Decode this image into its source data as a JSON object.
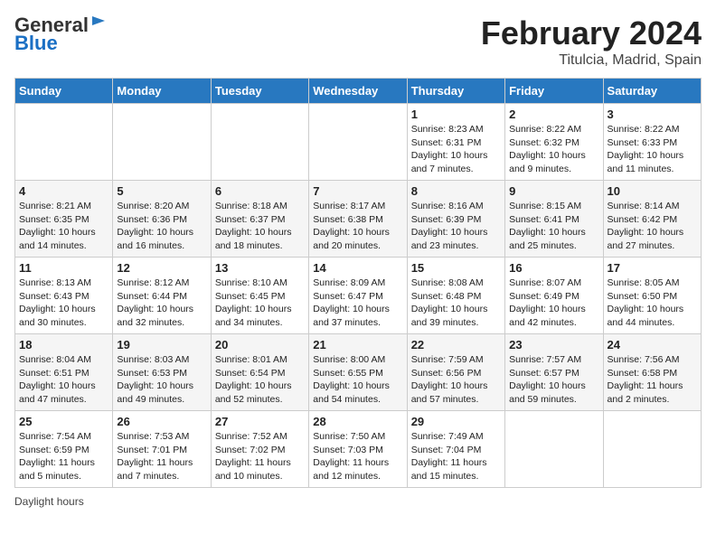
{
  "header": {
    "logo_general": "General",
    "logo_blue": "Blue",
    "month": "February 2024",
    "location": "Titulcia, Madrid, Spain"
  },
  "days_of_week": [
    "Sunday",
    "Monday",
    "Tuesday",
    "Wednesday",
    "Thursday",
    "Friday",
    "Saturday"
  ],
  "weeks": [
    [
      {
        "num": "",
        "info": ""
      },
      {
        "num": "",
        "info": ""
      },
      {
        "num": "",
        "info": ""
      },
      {
        "num": "",
        "info": ""
      },
      {
        "num": "1",
        "info": "Sunrise: 8:23 AM\nSunset: 6:31 PM\nDaylight: 10 hours and 7 minutes."
      },
      {
        "num": "2",
        "info": "Sunrise: 8:22 AM\nSunset: 6:32 PM\nDaylight: 10 hours and 9 minutes."
      },
      {
        "num": "3",
        "info": "Sunrise: 8:22 AM\nSunset: 6:33 PM\nDaylight: 10 hours and 11 minutes."
      }
    ],
    [
      {
        "num": "4",
        "info": "Sunrise: 8:21 AM\nSunset: 6:35 PM\nDaylight: 10 hours and 14 minutes."
      },
      {
        "num": "5",
        "info": "Sunrise: 8:20 AM\nSunset: 6:36 PM\nDaylight: 10 hours and 16 minutes."
      },
      {
        "num": "6",
        "info": "Sunrise: 8:18 AM\nSunset: 6:37 PM\nDaylight: 10 hours and 18 minutes."
      },
      {
        "num": "7",
        "info": "Sunrise: 8:17 AM\nSunset: 6:38 PM\nDaylight: 10 hours and 20 minutes."
      },
      {
        "num": "8",
        "info": "Sunrise: 8:16 AM\nSunset: 6:39 PM\nDaylight: 10 hours and 23 minutes."
      },
      {
        "num": "9",
        "info": "Sunrise: 8:15 AM\nSunset: 6:41 PM\nDaylight: 10 hours and 25 minutes."
      },
      {
        "num": "10",
        "info": "Sunrise: 8:14 AM\nSunset: 6:42 PM\nDaylight: 10 hours and 27 minutes."
      }
    ],
    [
      {
        "num": "11",
        "info": "Sunrise: 8:13 AM\nSunset: 6:43 PM\nDaylight: 10 hours and 30 minutes."
      },
      {
        "num": "12",
        "info": "Sunrise: 8:12 AM\nSunset: 6:44 PM\nDaylight: 10 hours and 32 minutes."
      },
      {
        "num": "13",
        "info": "Sunrise: 8:10 AM\nSunset: 6:45 PM\nDaylight: 10 hours and 34 minutes."
      },
      {
        "num": "14",
        "info": "Sunrise: 8:09 AM\nSunset: 6:47 PM\nDaylight: 10 hours and 37 minutes."
      },
      {
        "num": "15",
        "info": "Sunrise: 8:08 AM\nSunset: 6:48 PM\nDaylight: 10 hours and 39 minutes."
      },
      {
        "num": "16",
        "info": "Sunrise: 8:07 AM\nSunset: 6:49 PM\nDaylight: 10 hours and 42 minutes."
      },
      {
        "num": "17",
        "info": "Sunrise: 8:05 AM\nSunset: 6:50 PM\nDaylight: 10 hours and 44 minutes."
      }
    ],
    [
      {
        "num": "18",
        "info": "Sunrise: 8:04 AM\nSunset: 6:51 PM\nDaylight: 10 hours and 47 minutes."
      },
      {
        "num": "19",
        "info": "Sunrise: 8:03 AM\nSunset: 6:53 PM\nDaylight: 10 hours and 49 minutes."
      },
      {
        "num": "20",
        "info": "Sunrise: 8:01 AM\nSunset: 6:54 PM\nDaylight: 10 hours and 52 minutes."
      },
      {
        "num": "21",
        "info": "Sunrise: 8:00 AM\nSunset: 6:55 PM\nDaylight: 10 hours and 54 minutes."
      },
      {
        "num": "22",
        "info": "Sunrise: 7:59 AM\nSunset: 6:56 PM\nDaylight: 10 hours and 57 minutes."
      },
      {
        "num": "23",
        "info": "Sunrise: 7:57 AM\nSunset: 6:57 PM\nDaylight: 10 hours and 59 minutes."
      },
      {
        "num": "24",
        "info": "Sunrise: 7:56 AM\nSunset: 6:58 PM\nDaylight: 11 hours and 2 minutes."
      }
    ],
    [
      {
        "num": "25",
        "info": "Sunrise: 7:54 AM\nSunset: 6:59 PM\nDaylight: 11 hours and 5 minutes."
      },
      {
        "num": "26",
        "info": "Sunrise: 7:53 AM\nSunset: 7:01 PM\nDaylight: 11 hours and 7 minutes."
      },
      {
        "num": "27",
        "info": "Sunrise: 7:52 AM\nSunset: 7:02 PM\nDaylight: 11 hours and 10 minutes."
      },
      {
        "num": "28",
        "info": "Sunrise: 7:50 AM\nSunset: 7:03 PM\nDaylight: 11 hours and 12 minutes."
      },
      {
        "num": "29",
        "info": "Sunrise: 7:49 AM\nSunset: 7:04 PM\nDaylight: 11 hours and 15 minutes."
      },
      {
        "num": "",
        "info": ""
      },
      {
        "num": "",
        "info": ""
      }
    ]
  ],
  "footer": {
    "daylight_label": "Daylight hours"
  }
}
